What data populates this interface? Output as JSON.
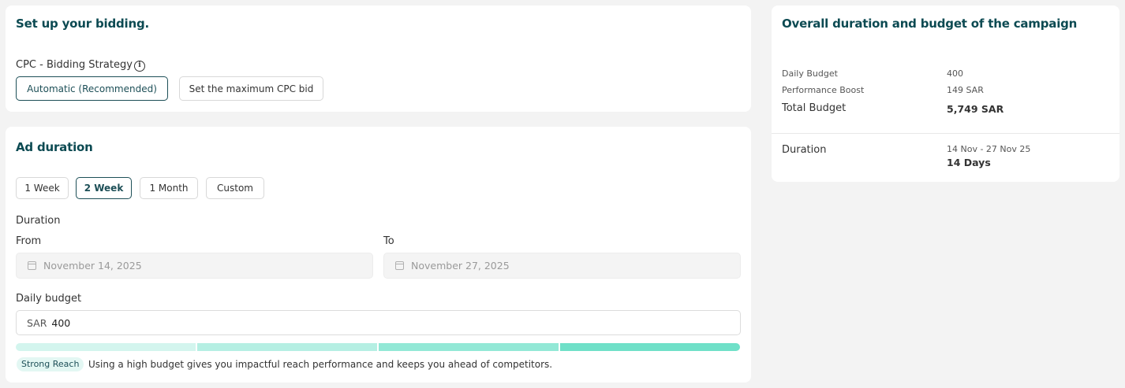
{
  "bidding": {
    "title": "Set up your bidding.",
    "strategy_label": "CPC - Bidding Strategy",
    "options": [
      "Automatic (Recommended)",
      "Set the maximum CPC bid"
    ],
    "selected": "Automatic (Recommended)"
  },
  "ad_duration": {
    "title": "Ad duration",
    "periods": [
      "1 Week",
      "2 Week",
      "1 Month",
      "Custom"
    ],
    "selected_period": "2 Week",
    "duration_label": "Duration",
    "from_label": "From",
    "from_value": "November 14, 2025",
    "to_label": "To",
    "to_value": "November 27, 2025",
    "daily_budget_label": "Daily budget",
    "currency": "SAR",
    "daily_budget_value": "400",
    "reach_badge": "Strong Reach",
    "reach_hint": "Using a high budget gives you impactful reach performance and keeps you ahead of competitors.",
    "reach_level": 1.0,
    "reach_colors": [
      "#d3f5ee",
      "#b5efe3",
      "#92e8d6",
      "#6fe0c8"
    ]
  },
  "summary": {
    "title": "Overall duration and budget of the campaign",
    "daily_budget_label": "Daily Budget",
    "daily_budget_value": "400",
    "boost_label": "Performance Boost",
    "boost_value": "149 SAR",
    "total_label": "Total Budget",
    "total_value": "5,749 SAR",
    "duration_label": "Duration",
    "duration_range": "14 Nov - 27 Nov 25",
    "duration_days": "14 Days"
  },
  "colors": {
    "accent": "#0c4a52",
    "selected_border": "#1d4f57",
    "badge_bg": "#e3f7f3"
  }
}
